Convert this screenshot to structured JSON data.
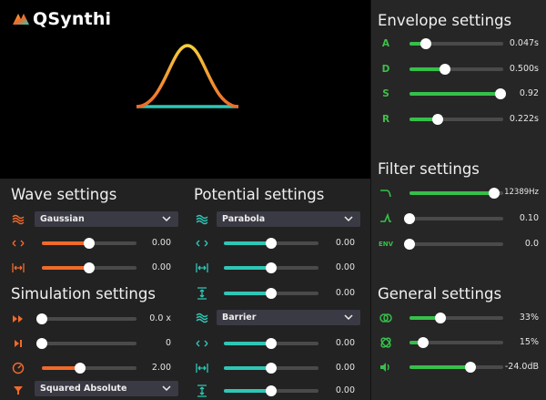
{
  "app": {
    "title": "QSynthi"
  },
  "colors": {
    "orange": "#f06a2a",
    "teal": "#2ec7b6",
    "green": "#35c04a",
    "track": "#4a4a4a"
  },
  "sections": {
    "wave": "Wave settings",
    "potential": "Potential settings",
    "simulation": "Simulation settings",
    "envelope": "Envelope settings",
    "filter": "Filter settings",
    "general": "General settings"
  },
  "wave": {
    "type": "Gaussian",
    "position": {
      "value": "0.00",
      "level": 0.5
    },
    "width": {
      "value": "0.00",
      "level": 0.5
    }
  },
  "simulation": {
    "speed": {
      "value": "0.0 x",
      "level": 0.0
    },
    "steps": {
      "value": "0",
      "level": 0.0
    },
    "gain": {
      "value": "2.00",
      "level": 0.4
    },
    "mode": "Squared Absolute"
  },
  "potential": {
    "type1": "Parabola",
    "p1_position": {
      "value": "0.00",
      "level": 0.5
    },
    "p1_width": {
      "value": "0.00",
      "level": 0.5
    },
    "p1_height": {
      "value": "0.00",
      "level": 0.5
    },
    "type2": "Barrier",
    "p2_position": {
      "value": "0.00",
      "level": 0.5
    },
    "p2_width": {
      "value": "0.00",
      "level": 0.5
    },
    "p2_height": {
      "value": "0.00",
      "level": 0.5
    }
  },
  "envelope": {
    "a": {
      "label": "A",
      "value": "0.047s",
      "level": 0.17
    },
    "d": {
      "label": "D",
      "value": "0.500s",
      "level": 0.38
    },
    "s": {
      "label": "S",
      "value": "0.92",
      "level": 0.97
    },
    "r": {
      "label": "R",
      "value": "0.222s",
      "level": 0.3
    }
  },
  "filter": {
    "lowpass": {
      "value": "12389Hz",
      "level": 0.9
    },
    "highpass": {
      "value": "0.10",
      "level": 0.0
    },
    "env": {
      "label": "ENV",
      "value": "0.0",
      "level": 0.0
    }
  },
  "general": {
    "voices": {
      "value": "33%",
      "level": 0.33
    },
    "spread": {
      "value": "15%",
      "level": 0.15
    },
    "volume": {
      "value": "-24.0dB",
      "level": 0.65
    }
  }
}
